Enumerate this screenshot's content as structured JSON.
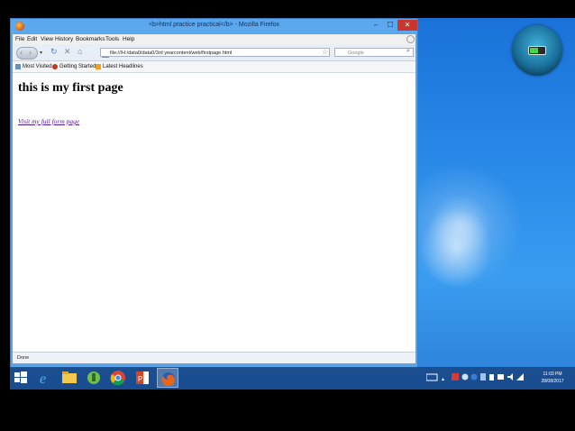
{
  "browser": {
    "window_title": "<b>html practice practical</b> - Mozilla Firefox",
    "controls": {
      "minimize": "–",
      "maximize": "☐",
      "close": "✕"
    },
    "menu": [
      {
        "label": "File"
      },
      {
        "label": "Edit"
      },
      {
        "label": "View"
      },
      {
        "label": "History"
      },
      {
        "label": "Bookmarks"
      },
      {
        "label": "Tools"
      },
      {
        "label": "Help"
      }
    ],
    "url": "file:///H:/data0/data0/3rd yearcontent/web/firstpage.html",
    "search_placeholder": "Google",
    "bookmarks": [
      {
        "label": "Most Visited"
      },
      {
        "label": "Getting Started"
      },
      {
        "label": "Latest Headlines"
      }
    ],
    "status": "Done"
  },
  "page": {
    "heading": "this is my first page",
    "link": "Visit my full form page"
  },
  "taskbar": {
    "clock_time": "11:03 PM",
    "clock_date": "28/08/2017"
  },
  "colors": {
    "close_button": "#c7372f",
    "visited_link": "#551a8b",
    "desktop_blue": "#2a8ae8"
  }
}
